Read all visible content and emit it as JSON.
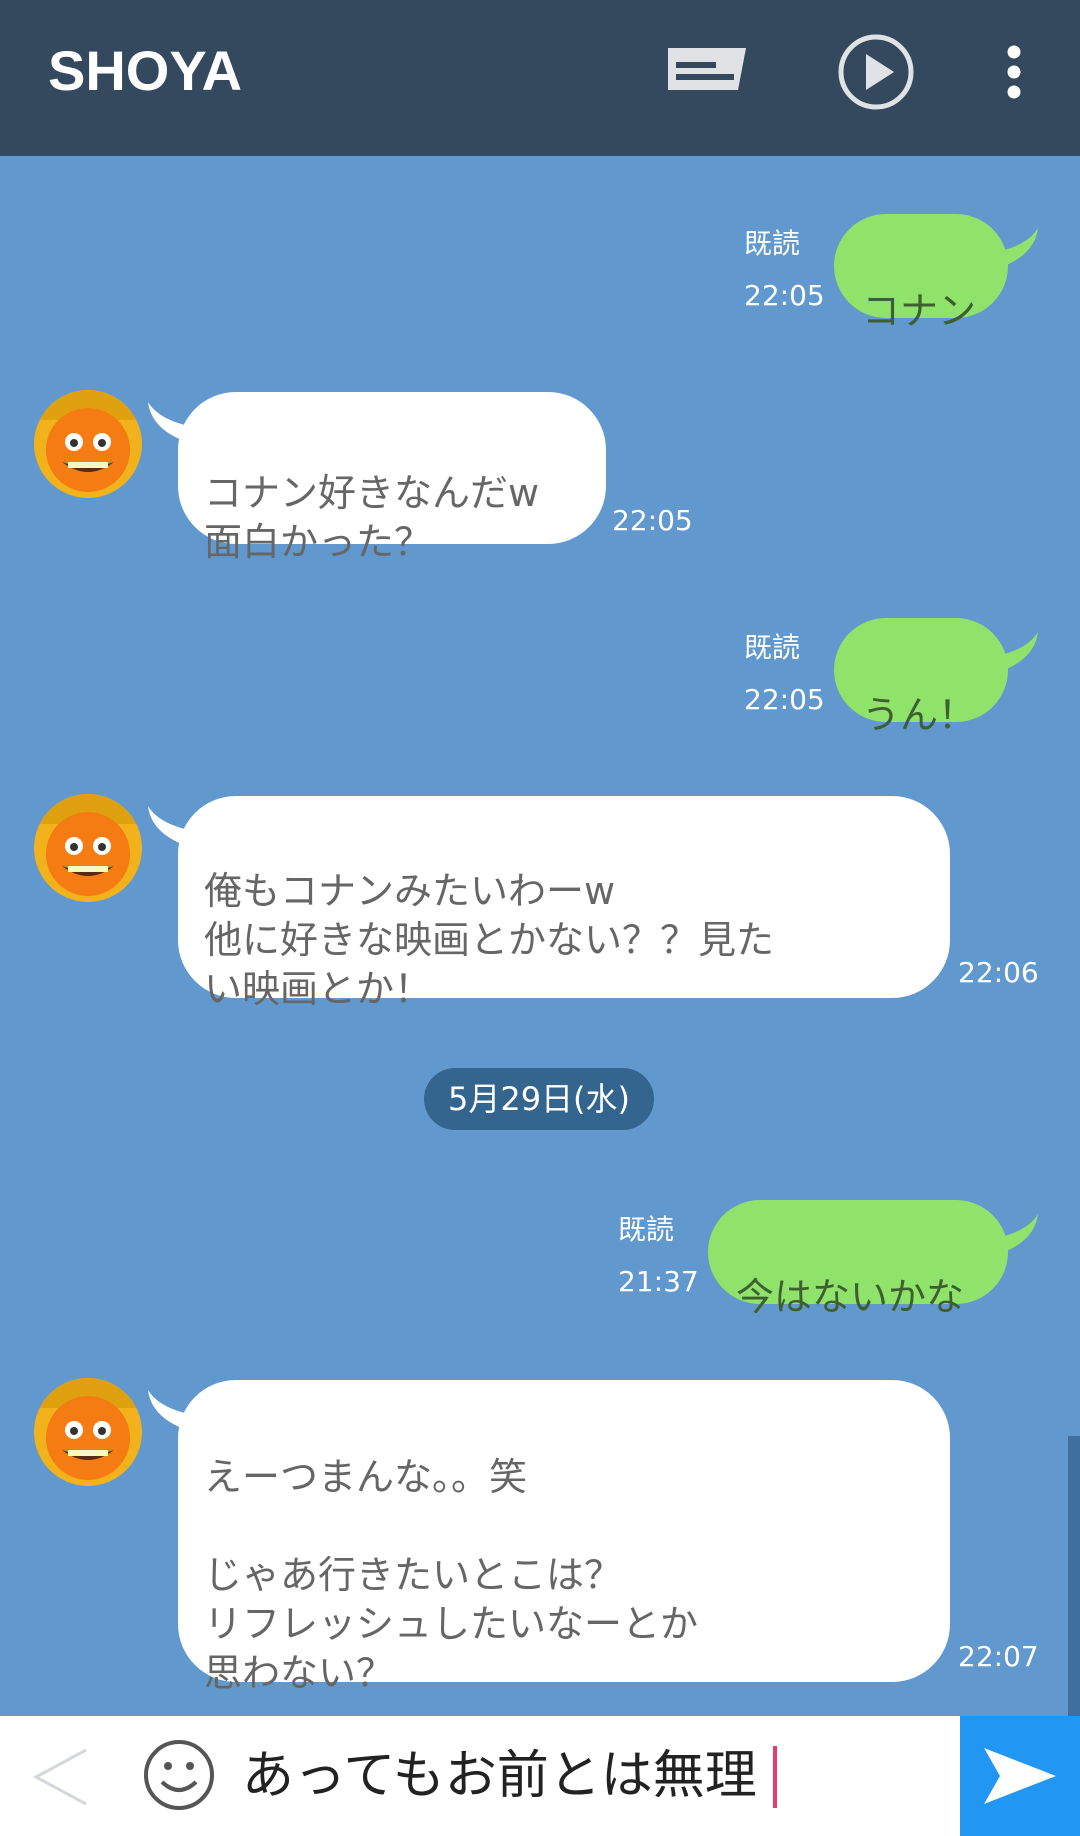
{
  "header": {
    "title": "SHOYA",
    "icons": [
      "message-list-icon",
      "play-icon",
      "more-vert-icon"
    ],
    "bg_color": "#34495e"
  },
  "colors": {
    "chat_bg": "#6199cf",
    "outgoing_bubble": "#8fe36b",
    "incoming_bubble": "#ffffff",
    "date_pill": "#33658f",
    "send_button": "#2196f3",
    "caret": "#e63d6b"
  },
  "messages": [
    {
      "direction": "out",
      "text": "コナン",
      "read": "既読",
      "time": "22:05"
    },
    {
      "direction": "in",
      "text": "コナン好きなんだw\n面白かった？",
      "time": "22:05"
    },
    {
      "direction": "out",
      "text": "うん！",
      "read": "既読",
      "time": "22:05"
    },
    {
      "direction": "in",
      "text": "俺もコナンみたいわーw\n他に好きな映画とかない？？見た\nい映画とか！",
      "time": "22:06"
    },
    {
      "direction": "out",
      "text": "今はないかな",
      "read": "既読",
      "time": "21:37"
    },
    {
      "direction": "in",
      "text": "えーつまんな。。笑\n\nじゃあ行きたいとこは？\nリフレッシュしたいなーとか\n思わない？",
      "time": "22:07"
    }
  ],
  "date_separator": "5月29日(水)",
  "input": {
    "value": "あってもお前とは無理"
  }
}
